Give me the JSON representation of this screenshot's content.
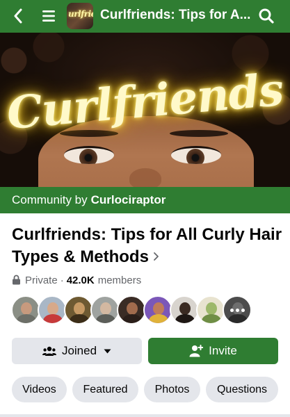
{
  "header": {
    "title": "Curlfriends: Tips for A...",
    "avatar_text": "urlfrien",
    "back_icon": "back-arrow-icon",
    "menu_icon": "hamburger-menu-icon",
    "search_icon": "search-icon",
    "bar_color": "#2f7d32"
  },
  "cover": {
    "neon_text": "Curlfriends",
    "neon_color": "#fff9c9"
  },
  "community": {
    "prefix": "Community by",
    "owner": "Curlociraptor"
  },
  "group": {
    "name": "Curlfriends: Tips for All Curly Hair Types & Methods",
    "privacy": "Private",
    "member_count": "42.0K",
    "members_label": "members",
    "lock_icon": "lock-icon",
    "chevron_icon": "chevron-right-icon"
  },
  "member_avatars": [
    {
      "bg": "#8b8f86",
      "head": "#c79a7e",
      "body": "#6d6f68"
    },
    {
      "bg": "#a9b7c6",
      "head": "#d7a98a",
      "body": "#c73a3a"
    },
    {
      "bg": "#6e5a32",
      "head": "#c69a64",
      "body": "#3b2d18"
    },
    {
      "bg": "#9fa3a0",
      "head": "#d3b8a1",
      "body": "#5c5e59"
    },
    {
      "bg": "#3a2c25",
      "head": "#a16b4d",
      "body": "#2a1e19"
    },
    {
      "bg": "#7b57b8",
      "head": "#c07b5a",
      "body": "#e0b23a"
    },
    {
      "bg": "#d8d4ce",
      "head": "#3a2a22",
      "body": "#1e1714"
    },
    {
      "bg": "#e8e3cf",
      "head": "#9db86a",
      "body": "#6f8e45"
    },
    {
      "bg": "#8a8a8a",
      "head": "#c9c9c9",
      "body": "#4e4e4e"
    }
  ],
  "actions": {
    "joined_label": "Joined",
    "invite_label": "Invite",
    "joined_icon": "group-people-icon",
    "invite_icon": "add-person-icon",
    "dropdown_icon": "caret-down-icon",
    "accent": "#2f7d32"
  },
  "tabs": [
    {
      "label": "Videos"
    },
    {
      "label": "Featured"
    },
    {
      "label": "Photos"
    },
    {
      "label": "Questions"
    }
  ]
}
